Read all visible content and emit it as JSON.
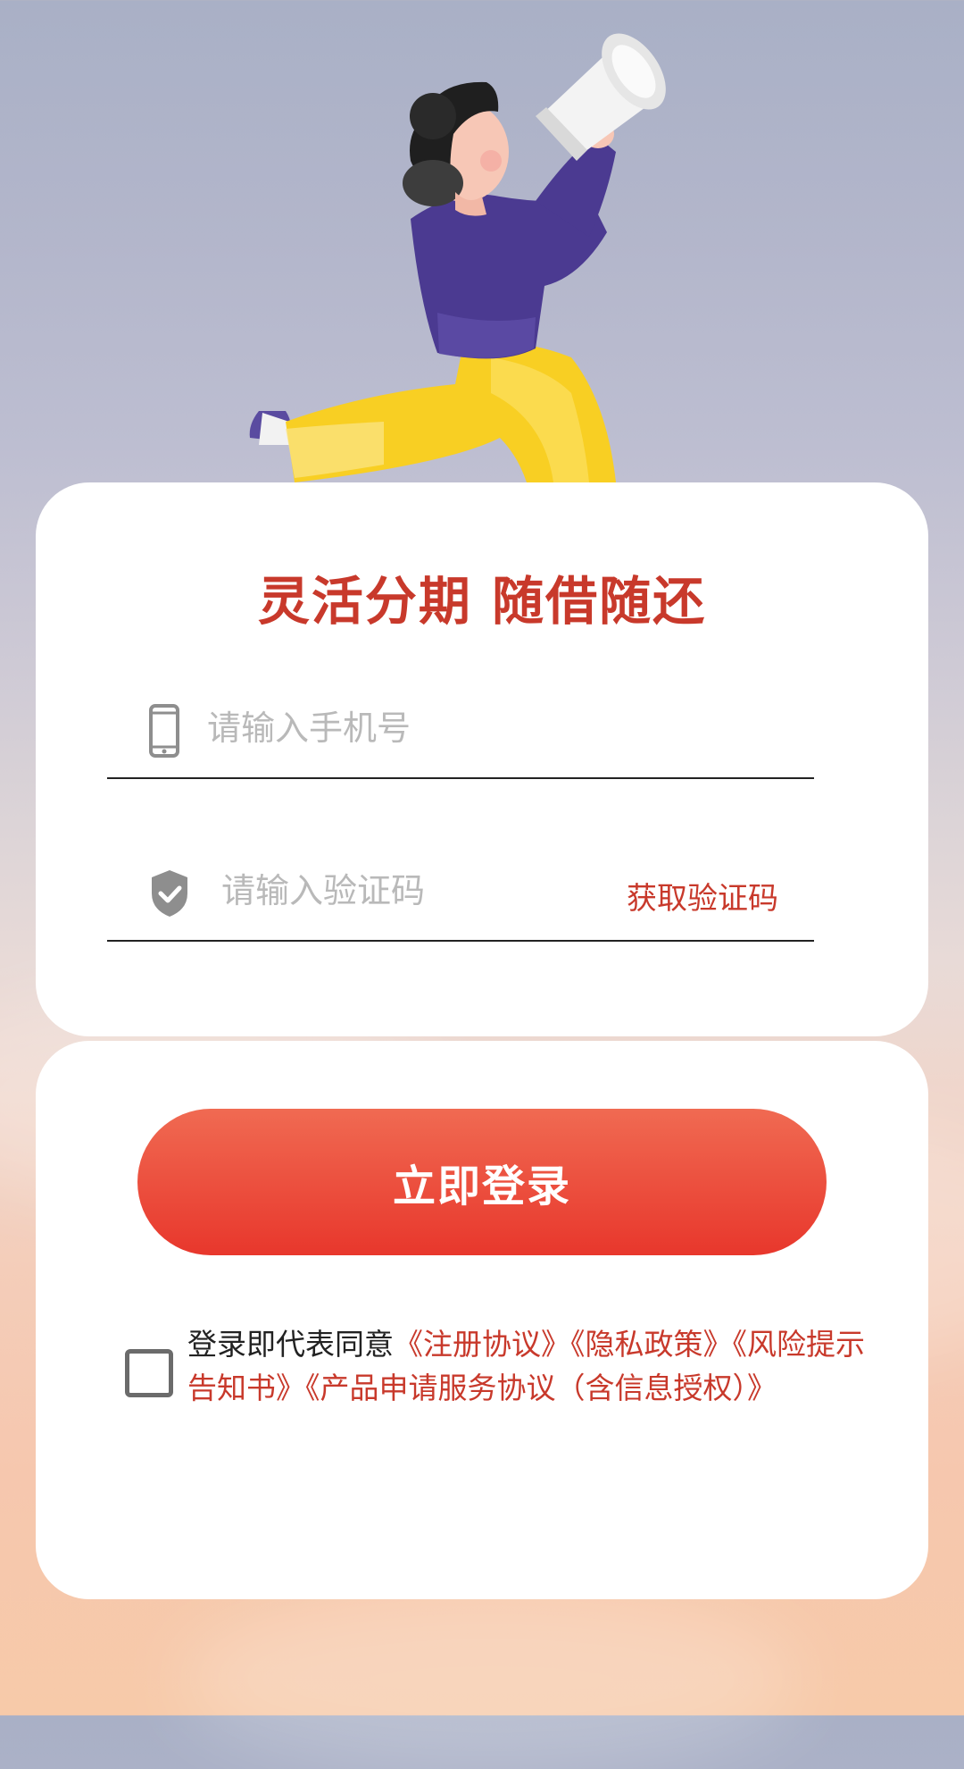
{
  "colors": {
    "accent": "#c8392b",
    "button_top": "#f06a52",
    "button_bottom": "#e8372c"
  },
  "headline": "灵活分期 随借随还",
  "phone_field": {
    "icon": "phone-icon",
    "placeholder": "请输入手机号"
  },
  "code_field": {
    "icon": "shield-check-icon",
    "placeholder": "请输入验证码",
    "get_code_label": "获取验证码"
  },
  "login_button": "立即登录",
  "agreement": {
    "checked": false,
    "prefix": "登录即代表同意",
    "links": [
      "《注册协议》",
      "《隐私政策》",
      "《风险提示告知书》",
      "《产品申请服务协议（含信息授权）》"
    ]
  }
}
